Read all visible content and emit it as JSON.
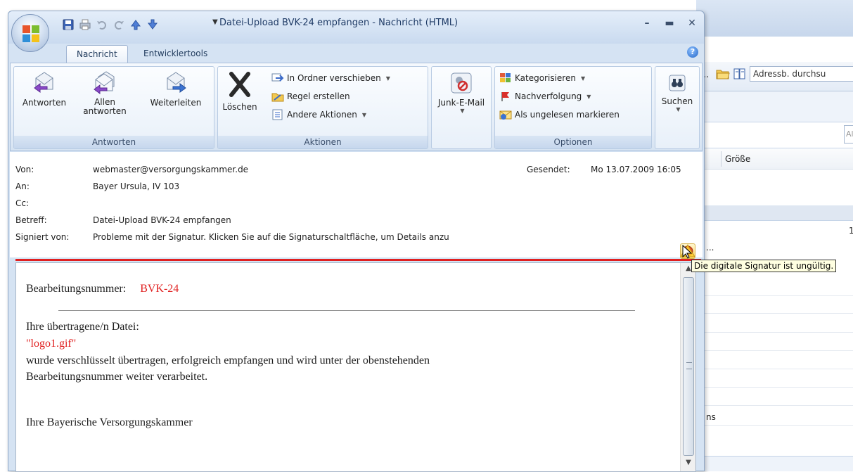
{
  "window": {
    "title": "Datei-Upload BVK-24 empfangen - Nachricht (HTML)"
  },
  "tabs": [
    {
      "label": "Nachricht",
      "active": true
    },
    {
      "label": "Entwicklertools",
      "active": false
    }
  ],
  "ribbon": {
    "antworten": {
      "label": "Antworten",
      "buttons": {
        "reply": "Antworten",
        "reply_all": "Allen antworten",
        "forward": "Weiterleiten"
      }
    },
    "aktionen": {
      "label": "Aktionen",
      "delete": "Löschen",
      "move_to_folder": "In Ordner verschieben",
      "create_rule": "Regel erstellen",
      "other_actions": "Andere Aktionen"
    },
    "junk": {
      "label": "Junk-E-Mail"
    },
    "optionen": {
      "label": "Optionen",
      "categorize": "Kategorisieren",
      "follow_up": "Nachverfolgung",
      "mark_unread": "Als ungelesen markieren"
    },
    "search": {
      "label": "Suchen"
    }
  },
  "header": {
    "from_label": "Von:",
    "from_value": "webmaster@versorgungskammer.de",
    "to_label": "An:",
    "to_value": "Bayer Ursula, IV 103",
    "cc_label": "Cc:",
    "cc_value": "",
    "subject_label": "Betreff:",
    "subject_value": "Datei-Upload BVK-24 empfangen",
    "signed_label": "Signiert von:",
    "signed_value": "Probleme mit der Signatur. Klicken Sie auf die Signaturschaltfläche, um Details anzu",
    "sent_label": "Gesendet:",
    "sent_value": "Mo 13.07.2009 16:05"
  },
  "body": {
    "proc_label": "Bearbeitungsnummer:",
    "proc_number": "BVK-24",
    "files_label": "Ihre übertragene/n Datei:",
    "file_name": "\"logo1.gif\"",
    "line1": "wurde verschlüsselt übertragen, erfolgreich empfangen und wird unter der obenstehenden",
    "line2": "Bearbeitungsnummer weiter verarbeitet.",
    "signature": "Ihre Bayerische Versorgungskammer"
  },
  "tooltip": "Die digitale Signatur ist ungültig.",
  "background_window": {
    "ellipsis": "..",
    "address_search": "Adressb. durchsu",
    "search_partial": "Al",
    "column_size": "Größe",
    "row_value": "1",
    "row_ellipsis": "...",
    "row_text": "ns"
  },
  "colors": {
    "accent_red": "#e02020",
    "ribbon_blue": "#d5e3f3"
  }
}
